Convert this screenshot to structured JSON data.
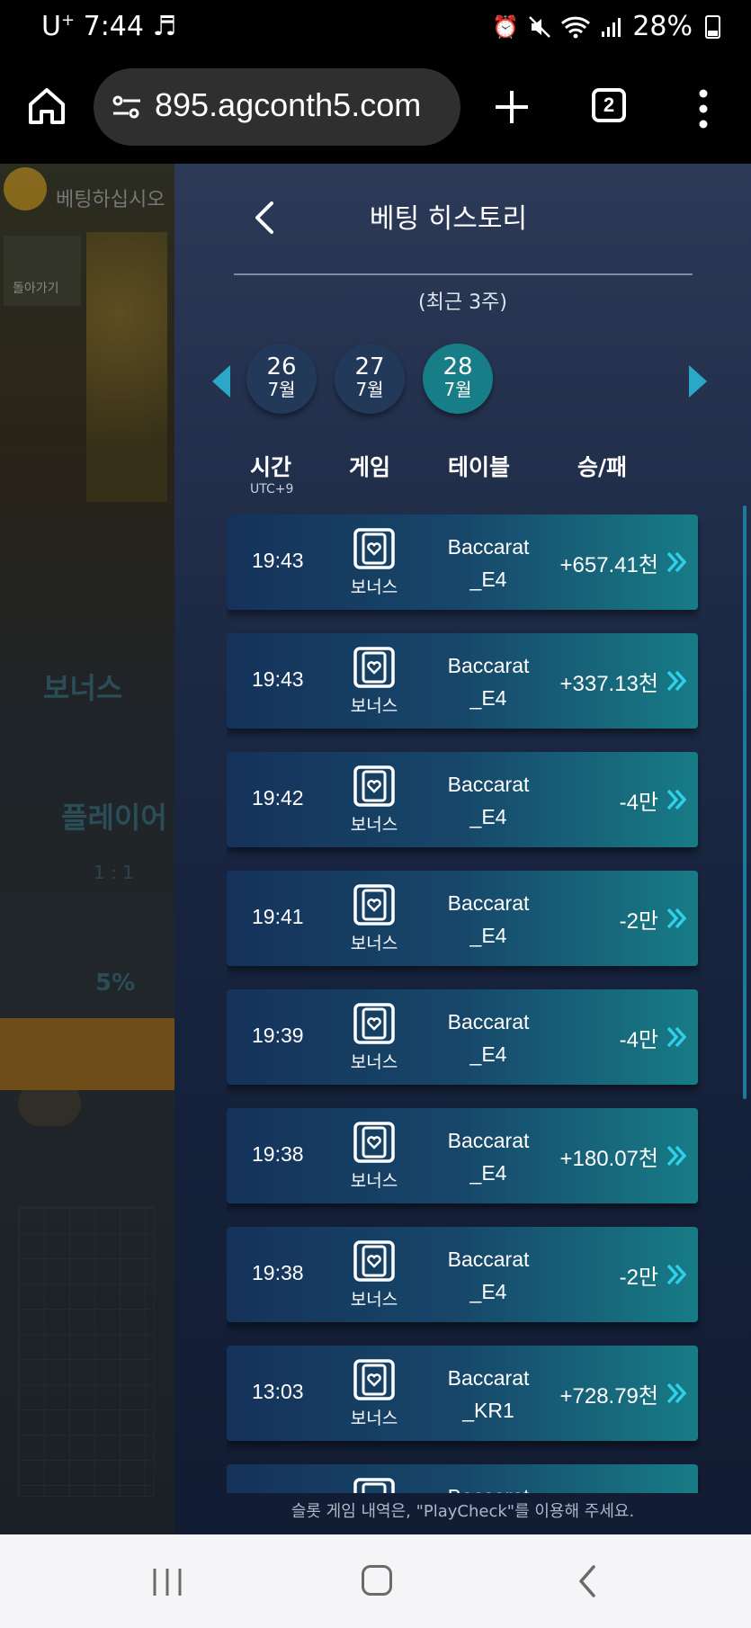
{
  "status_bar": {
    "carrier": "U",
    "carrier_sup": "+",
    "time": "7:44",
    "music_icon": "♬",
    "battery": "28%"
  },
  "browser": {
    "url": "895.agconth5.com",
    "tab_count": "2"
  },
  "background": {
    "header_text": "베팅하십시오",
    "back_label": "돌아가기",
    "bonus_label": "보너스",
    "player_label": "플레이어",
    "ratio": "1 : 1",
    "percent": "5%"
  },
  "panel": {
    "title": "베팅 히스토리",
    "period": "(최근 3주)",
    "dates": [
      {
        "day": "26",
        "month": "7월",
        "active": false
      },
      {
        "day": "27",
        "month": "7월",
        "active": false
      },
      {
        "day": "28",
        "month": "7월",
        "active": true
      }
    ],
    "headers": {
      "time": "시간",
      "timezone": "UTC+9",
      "game": "게임",
      "table": "테이블",
      "result": "승/패"
    },
    "rows": [
      {
        "time": "19:43",
        "game": "보너스",
        "table_line1": "Baccarat",
        "table_line2": "_E4",
        "amount": "+657.41천"
      },
      {
        "time": "19:43",
        "game": "보너스",
        "table_line1": "Baccarat",
        "table_line2": "_E4",
        "amount": "+337.13천"
      },
      {
        "time": "19:42",
        "game": "보너스",
        "table_line1": "Baccarat",
        "table_line2": "_E4",
        "amount": "-4만"
      },
      {
        "time": "19:41",
        "game": "보너스",
        "table_line1": "Baccarat",
        "table_line2": "_E4",
        "amount": "-2만"
      },
      {
        "time": "19:39",
        "game": "보너스",
        "table_line1": "Baccarat",
        "table_line2": "_E4",
        "amount": "-4만"
      },
      {
        "time": "19:38",
        "game": "보너스",
        "table_line1": "Baccarat",
        "table_line2": "_E4",
        "amount": "+180.07천"
      },
      {
        "time": "19:38",
        "game": "보너스",
        "table_line1": "Baccarat",
        "table_line2": "_E4",
        "amount": "-2만"
      },
      {
        "time": "13:03",
        "game": "보너스",
        "table_line1": "Baccarat",
        "table_line2": "_KR1",
        "amount": "+728.79천"
      },
      {
        "time": "",
        "game": "",
        "table_line1": "Baccarat",
        "table_line2": "",
        "amount": ""
      }
    ],
    "footer_note": "슬롯 게임 내역은, \"PlayCheck\"를 이용해 주세요."
  },
  "colors": {
    "accent": "#2aa8c6",
    "active_date": "#177d86",
    "panel_bg": "#1c2945"
  }
}
